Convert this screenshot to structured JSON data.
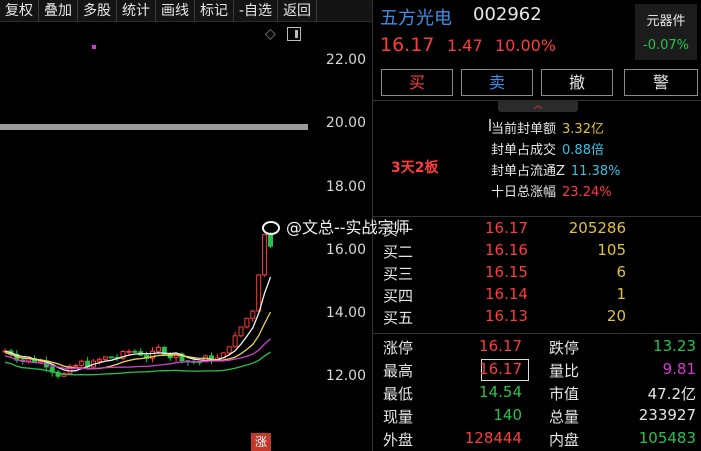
{
  "menu": [
    "复权",
    "叠加",
    "多股",
    "统计",
    "画线",
    "标记",
    "-自选",
    "返回"
  ],
  "chart": {
    "yticks": [
      "22.00",
      "20.00",
      "18.00",
      "16.00",
      "14.00",
      "12.00"
    ],
    "badge": "涨",
    "colors": {
      "up": "#ff3b3b",
      "down": "#27c24c",
      "ma_white": "#f0f0f0",
      "ma_yellow": "#e8d84a",
      "ma_magenta": "#d13bd1",
      "ma_green": "#27c24c"
    }
  },
  "stock": {
    "name": "五方光电",
    "code": "002962",
    "price": "16.17",
    "change": "1.47",
    "change_pct": "10.00%",
    "sector": "元器件",
    "sector_pct": "-0.07%"
  },
  "buttons": {
    "buy": "买",
    "sell": "卖",
    "cancel": "撤",
    "alert": "警"
  },
  "seal": {
    "collapse_icon": "chevron-up",
    "board_count": "3天2板",
    "rows": [
      {
        "label": "当前封单额",
        "value": "3.32亿",
        "color": "gold"
      },
      {
        "label": "封单占成交",
        "value": "0.88倍",
        "color": "cyan"
      },
      {
        "label": "封单占流通Z",
        "value": "11.38%",
        "color": "cyan"
      },
      {
        "label": "十日总涨幅",
        "value": "23.24%",
        "color": "red"
      }
    ]
  },
  "book": [
    {
      "label": "买一",
      "price": "16.17",
      "vol": "205286"
    },
    {
      "label": "买二",
      "price": "16.16",
      "vol": "105"
    },
    {
      "label": "买三",
      "price": "16.15",
      "vol": "6"
    },
    {
      "label": "买四",
      "price": "16.14",
      "vol": "1"
    },
    {
      "label": "买五",
      "price": "16.13",
      "vol": "20"
    }
  ],
  "stats": {
    "limit_up": {
      "label": "涨停",
      "value": "16.17"
    },
    "limit_down": {
      "label": "跌停",
      "value": "13.23"
    },
    "high": {
      "label": "最高",
      "value": "16.17"
    },
    "vol_ratio": {
      "label": "量比",
      "value": "9.81"
    },
    "low": {
      "label": "最低",
      "value": "14.54"
    },
    "mkt_cap": {
      "label": "市值",
      "value": "47.2亿"
    },
    "cur_vol": {
      "label": "现量",
      "value": "140"
    },
    "total_vol": {
      "label": "总量",
      "value": "233927"
    },
    "outer": {
      "label": "外盘",
      "value": "128444"
    },
    "inner": {
      "label": "内盘",
      "value": "105483"
    }
  },
  "watermark": "@文总--实战宗师"
}
